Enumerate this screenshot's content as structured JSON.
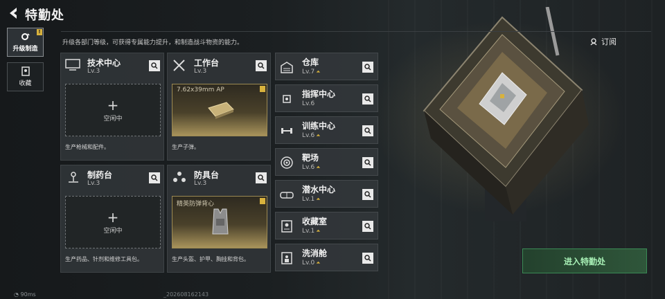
{
  "header": {
    "title": "特勤处"
  },
  "subtitle": "升级各部门等级，可获得专属能力提升，和制造战斗物资的能力。",
  "tabs": [
    {
      "label": "升级制造",
      "badge": "!"
    },
    {
      "label": "收藏"
    }
  ],
  "cards": [
    {
      "name": "技术中心",
      "level": "Lv.3",
      "slot_idle": "空闲中",
      "desc": "生产枪械和配件。"
    },
    {
      "name": "工作台",
      "level": "Lv.3",
      "item": "7.62x39mm AP",
      "desc": "生产子弹。"
    },
    {
      "name": "制药台",
      "level": "Lv.3",
      "slot_idle": "空闲中",
      "desc": "生产药品、针剂和维修工具包。"
    },
    {
      "name": "防具台",
      "level": "Lv.3",
      "item": "精英防弹背心",
      "desc": "生产头盔、护甲、胸挂和背包。"
    }
  ],
  "rows": [
    {
      "name": "仓库",
      "level": "Lv.7"
    },
    {
      "name": "指挥中心",
      "level": "Lv.6"
    },
    {
      "name": "训练中心",
      "level": "Lv.6"
    },
    {
      "name": "靶场",
      "level": "Lv.6"
    },
    {
      "name": "潜水中心",
      "level": "Lv.1"
    },
    {
      "name": "收藏室",
      "level": "Lv.1"
    },
    {
      "name": "洗消舱",
      "level": "Lv.0"
    }
  ],
  "subscribe_label": "订阅",
  "enter_label": "进入特勤处",
  "footer": {
    "ping": "90ms",
    "build": "_202608162143"
  },
  "colors": {
    "accent_gold": "#d8b23d",
    "enter_green": "#a8f0b6"
  }
}
